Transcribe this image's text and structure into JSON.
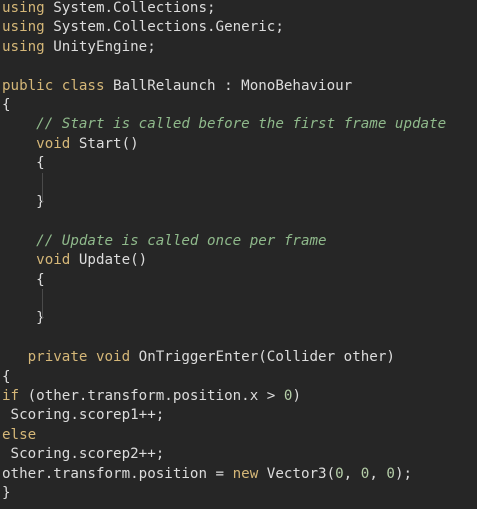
{
  "lines": [
    [
      {
        "t": "using",
        "c": "kw"
      },
      {
        "t": " System.Collections;"
      }
    ],
    [
      {
        "t": "using",
        "c": "kw"
      },
      {
        "t": " System.Collections.Generic;"
      }
    ],
    [
      {
        "t": "using",
        "c": "kw"
      },
      {
        "t": " UnityEngine;"
      }
    ],
    [],
    [
      {
        "t": "public",
        "c": "kw"
      },
      {
        "t": " "
      },
      {
        "t": "class",
        "c": "kw"
      },
      {
        "t": " BallRelaunch : MonoBehaviour"
      }
    ],
    [
      {
        "t": "{"
      }
    ],
    [
      {
        "t": "    "
      },
      {
        "t": "// Start is called before the first frame update",
        "c": "cm"
      }
    ],
    [
      {
        "t": "    "
      },
      {
        "t": "void",
        "c": "kw"
      },
      {
        "t": " Start()"
      }
    ],
    [
      {
        "t": "    {"
      }
    ],
    [],
    [
      {
        "t": "    }"
      }
    ],
    [],
    [
      {
        "t": "    "
      },
      {
        "t": "// Update is called once per frame",
        "c": "cm"
      }
    ],
    [
      {
        "t": "    "
      },
      {
        "t": "void",
        "c": "kw"
      },
      {
        "t": " Update()"
      }
    ],
    [
      {
        "t": "    {"
      }
    ],
    [],
    [
      {
        "t": "    }"
      }
    ],
    [],
    [
      {
        "t": "   "
      },
      {
        "t": "private",
        "c": "kw"
      },
      {
        "t": " "
      },
      {
        "t": "void",
        "c": "kw"
      },
      {
        "t": " OnTriggerEnter(Collider other)"
      }
    ],
    [
      {
        "t": "{"
      }
    ],
    [
      {
        "t": "if",
        "c": "kw"
      },
      {
        "t": " (other.transform.position.x > "
      },
      {
        "t": "0",
        "c": "num"
      },
      {
        "t": ")"
      }
    ],
    [
      {
        "t": " Scoring.scorep1++;"
      }
    ],
    [
      {
        "t": "else",
        "c": "kw"
      }
    ],
    [
      {
        "t": " Scoring.scorep2++;"
      }
    ],
    [
      {
        "t": "other.transform.position = "
      },
      {
        "t": "new",
        "c": "kw"
      },
      {
        "t": " Vector3("
      },
      {
        "t": "0",
        "c": "num"
      },
      {
        "t": ", "
      },
      {
        "t": "0",
        "c": "num"
      },
      {
        "t": ", "
      },
      {
        "t": "0",
        "c": "num"
      },
      {
        "t": ");"
      }
    ],
    [
      {
        "t": "}"
      }
    ]
  ]
}
